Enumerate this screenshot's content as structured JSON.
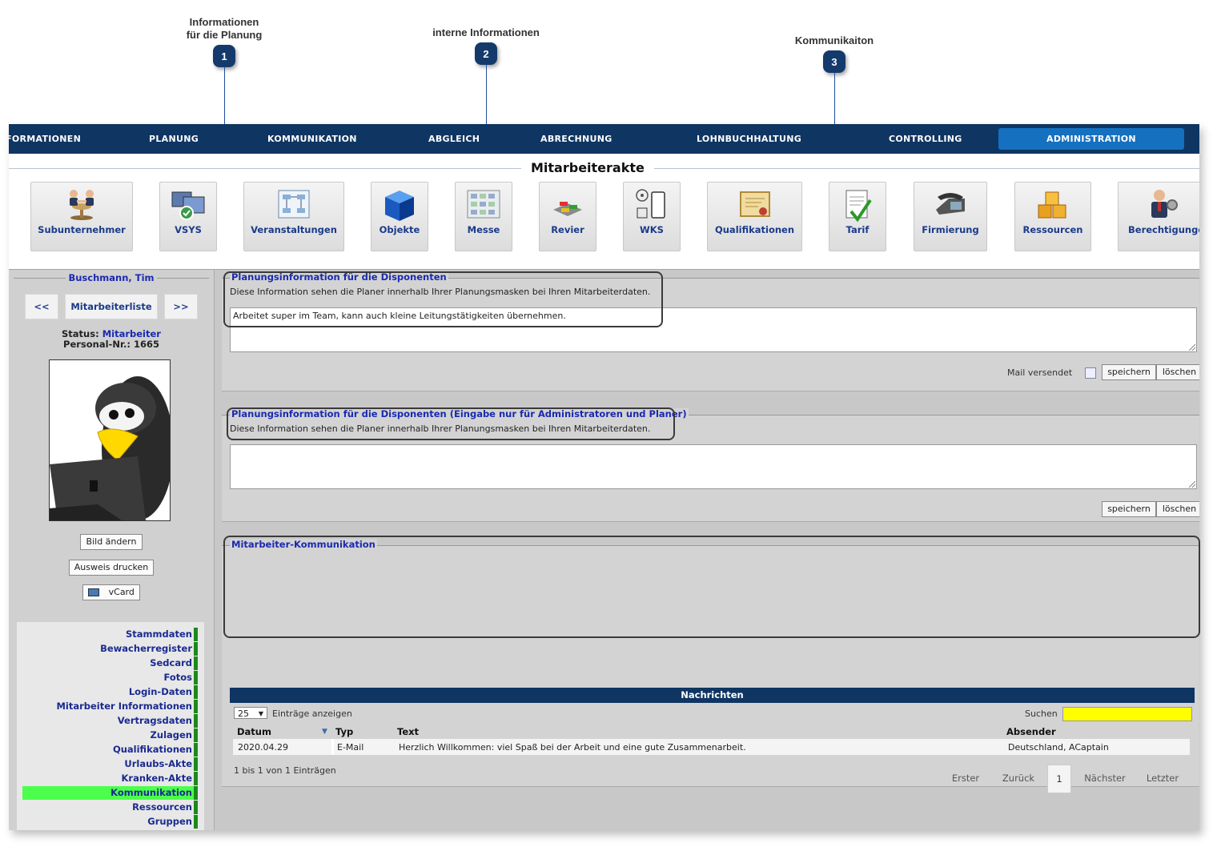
{
  "annotations": [
    {
      "badge": "1",
      "label_line1": "Informationen",
      "label_line2": "für die Planung"
    },
    {
      "badge": "2",
      "label_line1": "interne Informationen",
      "label_line2": ""
    },
    {
      "badge": "3",
      "label_line1": "Kommunikaiton",
      "label_line2": ""
    }
  ],
  "topnav": {
    "items": [
      "FORMATIONEN",
      "PLANUNG",
      "KOMMUNIKATION",
      "ABGLEICH",
      "ABRECHNUNG",
      "LOHNBUCHHALTUNG",
      "CONTROLLING",
      "ADMINISTRATION"
    ],
    "active": "ADMINISTRATION"
  },
  "page_title": "Mitarbeiterakte",
  "modules": [
    {
      "label": "Subunternehmer",
      "icon": "handshake-icon"
    },
    {
      "label": "VSYS",
      "icon": "monitors-icon"
    },
    {
      "label": "Veranstaltungen",
      "icon": "flowchart-icon"
    },
    {
      "label": "Objekte",
      "icon": "cube-icon"
    },
    {
      "label": "Messe",
      "icon": "floorplan-icon"
    },
    {
      "label": "Revier",
      "icon": "cars-icon"
    },
    {
      "label": "WKS",
      "icon": "nfc-icon"
    },
    {
      "label": "Qualifikationen",
      "icon": "certificate-icon"
    },
    {
      "label": "Tarif",
      "icon": "document-check-icon"
    },
    {
      "label": "Firmierung",
      "icon": "telephone-icon"
    },
    {
      "label": "Ressourcen",
      "icon": "boxes-icon"
    },
    {
      "label": "Berechtigunge",
      "icon": "user-settings-icon"
    }
  ],
  "sidebar": {
    "employee_name": "Buschmann, Tim",
    "prev_label": "<<",
    "list_label": "Mitarbeiterliste",
    "next_label": ">>",
    "status_label": "Status:",
    "status_value": "Mitarbeiter",
    "personal_nr_label": "Personal-Nr.:",
    "personal_nr_value": "1665",
    "change_picture": "Bild ändern",
    "print_id": "Ausweis drucken",
    "vcard": "vCard",
    "menu": [
      "Stammdaten",
      "Bewacherregister",
      "Sedcard",
      "Fotos",
      "Login-Daten",
      "Mitarbeiter Informationen",
      "Vertragsdaten",
      "Zulagen",
      "Qualifikationen",
      "Urlaubs-Akte",
      "Kranken-Akte",
      "Kommunikation",
      "Ressourcen",
      "Gruppen"
    ],
    "active_menu": "Kommunikation"
  },
  "planning_info": {
    "legend": "Planungsinformation für die Disponenten",
    "description": "Diese Information sehen die Planer innerhalb Ihrer Planungsmasken bei Ihren Mitarbeiterdaten.",
    "text": "Arbeitet super im Team, kann auch kleine Leitungstätigkeiten übernehmen.",
    "mail_sent_label": "Mail versendet",
    "save": "speichern",
    "delete": "löschen"
  },
  "internal_info": {
    "legend": "Planungsinformation für die Disponenten (Eingabe nur für Administratoren und Planer)",
    "description": "Diese Information sehen die Planer innerhalb Ihrer Planungsmasken bei Ihren Mitarbeiterdaten.",
    "text": "",
    "save": "speichern",
    "delete": "löschen"
  },
  "communication": {
    "legend": "Mitarbeiter-Kommunikation",
    "table_title": "Nachrichten",
    "page_size": "25",
    "entries_label": "Einträge anzeigen",
    "search_label": "Suchen",
    "search_value": "",
    "columns": [
      "Datum",
      "Typ",
      "Text",
      "Absender"
    ],
    "rows": [
      {
        "datum": "2020.04.29",
        "typ": "E-Mail",
        "text": "Herzlich Willkommen: viel Spaß bei der Arbeit und eine gute Zusammenarbeit.",
        "absender": "Deutschland, ACaptain"
      }
    ],
    "info": "1 bis 1 von 1 Einträgen",
    "pagination": {
      "first": "Erster",
      "prev": "Zurück",
      "current": "1",
      "next": "Nächster",
      "last": "Letzter"
    }
  },
  "colors": {
    "nav": "#0f3562",
    "active_tab": "#1570c0",
    "link": "#1a2ab0",
    "active_menu": "#4dff4d",
    "search_bg": "#ffff00"
  }
}
